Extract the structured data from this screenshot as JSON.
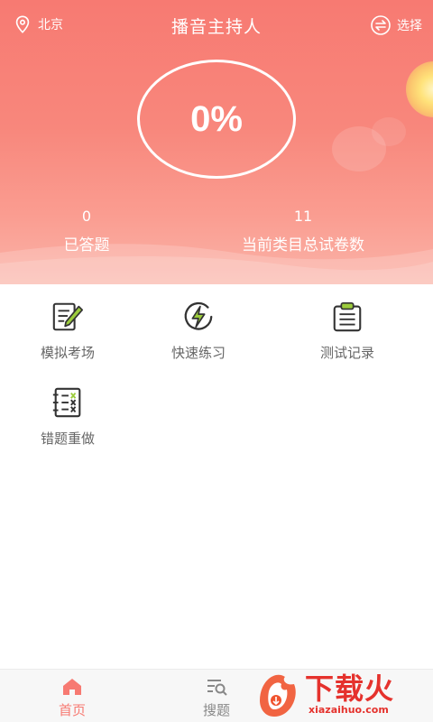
{
  "header": {
    "location": "北京",
    "title": "播音主持人",
    "choose_label": "选择",
    "progress_text": "0%",
    "stats": [
      {
        "value": "0",
        "label": "已答题"
      },
      {
        "value": "11",
        "label": "当前类目总试卷数"
      }
    ]
  },
  "features": [
    {
      "label": "模拟考场",
      "icon": "exam-edit-icon"
    },
    {
      "label": "快速练习",
      "icon": "lightning-icon"
    },
    {
      "label": "测试记录",
      "icon": "clipboard-icon"
    },
    {
      "label": "错题重做",
      "icon": "wrong-list-icon"
    }
  ],
  "nav": {
    "home_label": "首页",
    "search_label": "搜题"
  },
  "watermark": {
    "text": "下载火",
    "sub": "xiazaihuo.com"
  },
  "colors": {
    "accent": "#f77a72",
    "icon_dark": "#333333",
    "icon_green": "#9ccc3c"
  }
}
